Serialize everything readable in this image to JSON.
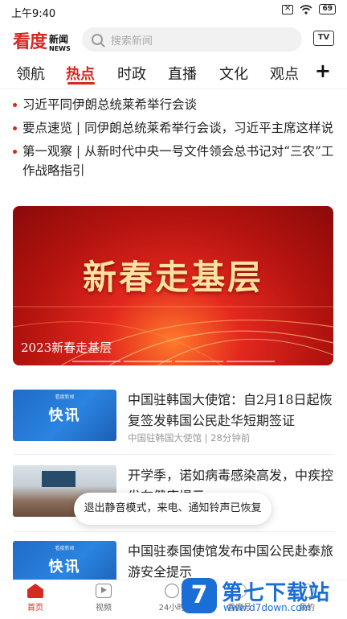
{
  "status_bar": {
    "time": "上午9:40",
    "battery": "69"
  },
  "header": {
    "logo_main": "看度",
    "logo_cn": "新闻",
    "logo_en": "NEWS",
    "search_placeholder": "搜索新闻",
    "tv_label": "TV"
  },
  "tabs": [
    {
      "label": "领航"
    },
    {
      "label": "热点",
      "active": true
    },
    {
      "label": "时政"
    },
    {
      "label": "直播"
    },
    {
      "label": "文化"
    },
    {
      "label": "观点"
    }
  ],
  "tabs_more": "+",
  "headlines": [
    "习近平同伊朗总统莱希举行会谈",
    "要点速览 | 同伊朗总统莱希举行会谈，习近平主席这样说",
    "第一观察 | 从新时代中央一号文件领会总书记对“三农”工作战略指引"
  ],
  "banner": {
    "title": "新春走基层",
    "caption": "2023新春走基层"
  },
  "news": [
    {
      "title": "中国驻韩国大使馆：自2月18日起恢复签发韩国公民赴华短期签证",
      "meta": "中国驻韩国大使馆 | 28分钟前",
      "thumb_text": "快讯",
      "thumb_small": "看度新闻"
    },
    {
      "title": "开学季，诺如病毒感染高发，中疾控发布健康提示",
      "meta": "",
      "thumb_text": "",
      "thumb_small": ""
    },
    {
      "title": "中国驻泰国使馆发布中国公民赴泰旅游安全提示",
      "meta": "",
      "thumb_text": "快讯",
      "thumb_small": "看度新闻"
    }
  ],
  "toast": "退出静音模式，来电、通知铃声已恢复",
  "bottom_nav": [
    {
      "label": "首页",
      "icon": "home-icon",
      "active": true
    },
    {
      "label": "视频",
      "icon": "video-icon"
    },
    {
      "label": "24小时",
      "icon": "clock-icon"
    },
    {
      "label": "看度号",
      "icon": "account-icon"
    },
    {
      "label": "我的",
      "icon": "profile-icon"
    }
  ],
  "watermark": {
    "logo": "7",
    "text": "第七下载站",
    "url": "www.d7down.com"
  },
  "colors": {
    "accent": "#d6291f",
    "thumb_blue": "#2a84e0",
    "watermark_blue": "#1a6ed6"
  }
}
